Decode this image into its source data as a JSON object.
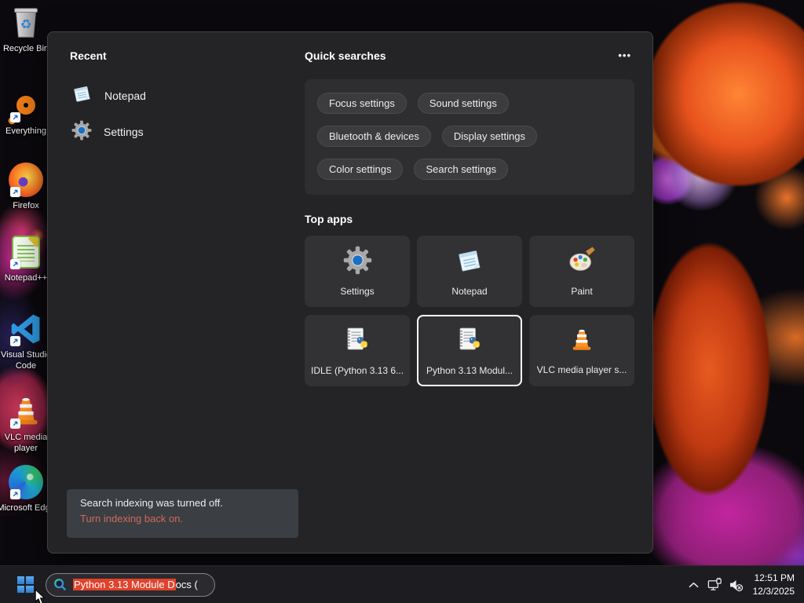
{
  "search_panel": {
    "recent": {
      "title": "Recent",
      "items": [
        {
          "label": "Notepad",
          "icon": "notepad-icon"
        },
        {
          "label": "Settings",
          "icon": "settings-gear-icon"
        }
      ]
    },
    "quick_searches": {
      "title": "Quick searches",
      "more_label": "•••",
      "pills": [
        "Focus settings",
        "Sound settings",
        "Bluetooth & devices",
        "Display settings",
        "Color settings",
        "Search settings"
      ]
    },
    "top_apps": {
      "title": "Top apps",
      "tiles": [
        {
          "label": "Settings",
          "icon": "settings-gear-icon",
          "selected": false
        },
        {
          "label": "Notepad",
          "icon": "notepad-icon",
          "selected": false
        },
        {
          "label": "Paint",
          "icon": "paint-palette-icon",
          "selected": false
        },
        {
          "label": "IDLE (Python 3.13 6...",
          "icon": "python-doc-icon",
          "selected": false
        },
        {
          "label": "Python 3.13 Modul...",
          "icon": "python-doc-icon",
          "selected": true
        },
        {
          "label": "VLC media player s...",
          "icon": "vlc-cone-icon",
          "selected": false
        }
      ]
    },
    "notice": {
      "message": "Search indexing was turned off.",
      "action_label": "Turn indexing back on."
    }
  },
  "desktop": {
    "icons": [
      {
        "label": "Recycle Bin",
        "icon": "recycle-bin-icon"
      },
      {
        "label": "Everything",
        "icon": "everything-search-icon"
      },
      {
        "label": "Firefox",
        "icon": "firefox-icon"
      },
      {
        "label": "Notepad++",
        "icon": "notepad-plus-plus-icon"
      },
      {
        "label": "Visual Studio Code",
        "icon": "vscode-icon"
      },
      {
        "label": "VLC media player",
        "icon": "vlc-cone-icon"
      },
      {
        "label": "Microsoft Edge",
        "icon": "edge-icon"
      }
    ]
  },
  "taskbar": {
    "search_box": {
      "highlighted_text": "Python 3.13 Module D",
      "rest_text": "ocs ("
    },
    "clock": {
      "time": "12:51 PM",
      "date": "12/3/2025"
    }
  },
  "colors": {
    "selection_highlight": "#e1422b",
    "notice_link": "#cd6a61",
    "panel_background": "#242426",
    "taskbar_background": "#1d1d21",
    "accent_blue": "#4a9fe8"
  }
}
